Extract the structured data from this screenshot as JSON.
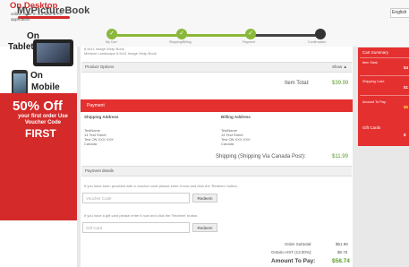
{
  "header": {
    "logo": "MyPictureBook",
    "language": "English",
    "steps": [
      {
        "label": "My Cart",
        "icon": "check-icon"
      },
      {
        "label": "Shipping/Billing",
        "icon": "check-icon"
      },
      {
        "label": "Payment",
        "icon": "check-icon"
      },
      {
        "label": "Confirmation",
        "icon": "dot-icon"
      }
    ]
  },
  "ad": {
    "line1": "On Desktop",
    "line1_desc": "online order in our Mac & PC application",
    "on": "On",
    "tablet": "Tablet",
    "mobile": "Mobile",
    "promo_big": "50% Off",
    "promo_mid": "your first order Use Voucher Code",
    "promo_code": "FIRST"
  },
  "order": {
    "product_lines": [
      "8.5x11 Image Wrap Book",
      "Medium Landscape 8.5x11 Image Wrap Book"
    ],
    "product_options_label": "Product Options",
    "show_label": "Show ▲",
    "item_total_label": "Item Total:",
    "item_total_value": "$39.99"
  },
  "payment": {
    "title": "Payment",
    "shipping_address_label": "Shipping Address",
    "billing_address_label": "Billing Address",
    "shipping_address": [
      "TestName",
      "14 Test Street",
      "Test ON XXX XXX",
      "Canada"
    ],
    "billing_address": [
      "TestName",
      "14 Test Street",
      "Test ON XXX XXX",
      "Canada"
    ],
    "shipping_label": "Shipping (Shipping Via Canada Post):",
    "shipping_value": "$11.99",
    "details_label": "Payment details",
    "voucher_prompt": "If you have been provided with a voucher code please enter it now and click the 'Redeem' button.",
    "voucher_placeholder": "Voucher Code",
    "redeem_label": "Redeem",
    "gift_prompt": "If you have a gift card please enter it now and click the 'Redeem' button.",
    "gift_placeholder": "Gift Card",
    "redeem_label_2": "Redeem",
    "subtotal_label": "Order Subtotal:",
    "subtotal_value": "$51.98",
    "hst_label": "Ontario HST (13.00%):",
    "hst_value": "$6.76",
    "amount_label": "Amount To Pay:",
    "amount_value": "$58.74"
  },
  "cart": {
    "title": "Cart Summary",
    "item_total_label": "Item Total:",
    "item_total_value": "$4",
    "shipping_cost_label": "Shipping Cost:",
    "shipping_cost_value": "$1",
    "amount_label": "Amount To Pay:",
    "amount_value": "$5",
    "gift_cards_label": "Gift Cards",
    "gift_cards_value": "$"
  },
  "colors": {
    "accent": "#e53030",
    "progress": "#8ab83a",
    "total": "#5b9b2a"
  }
}
